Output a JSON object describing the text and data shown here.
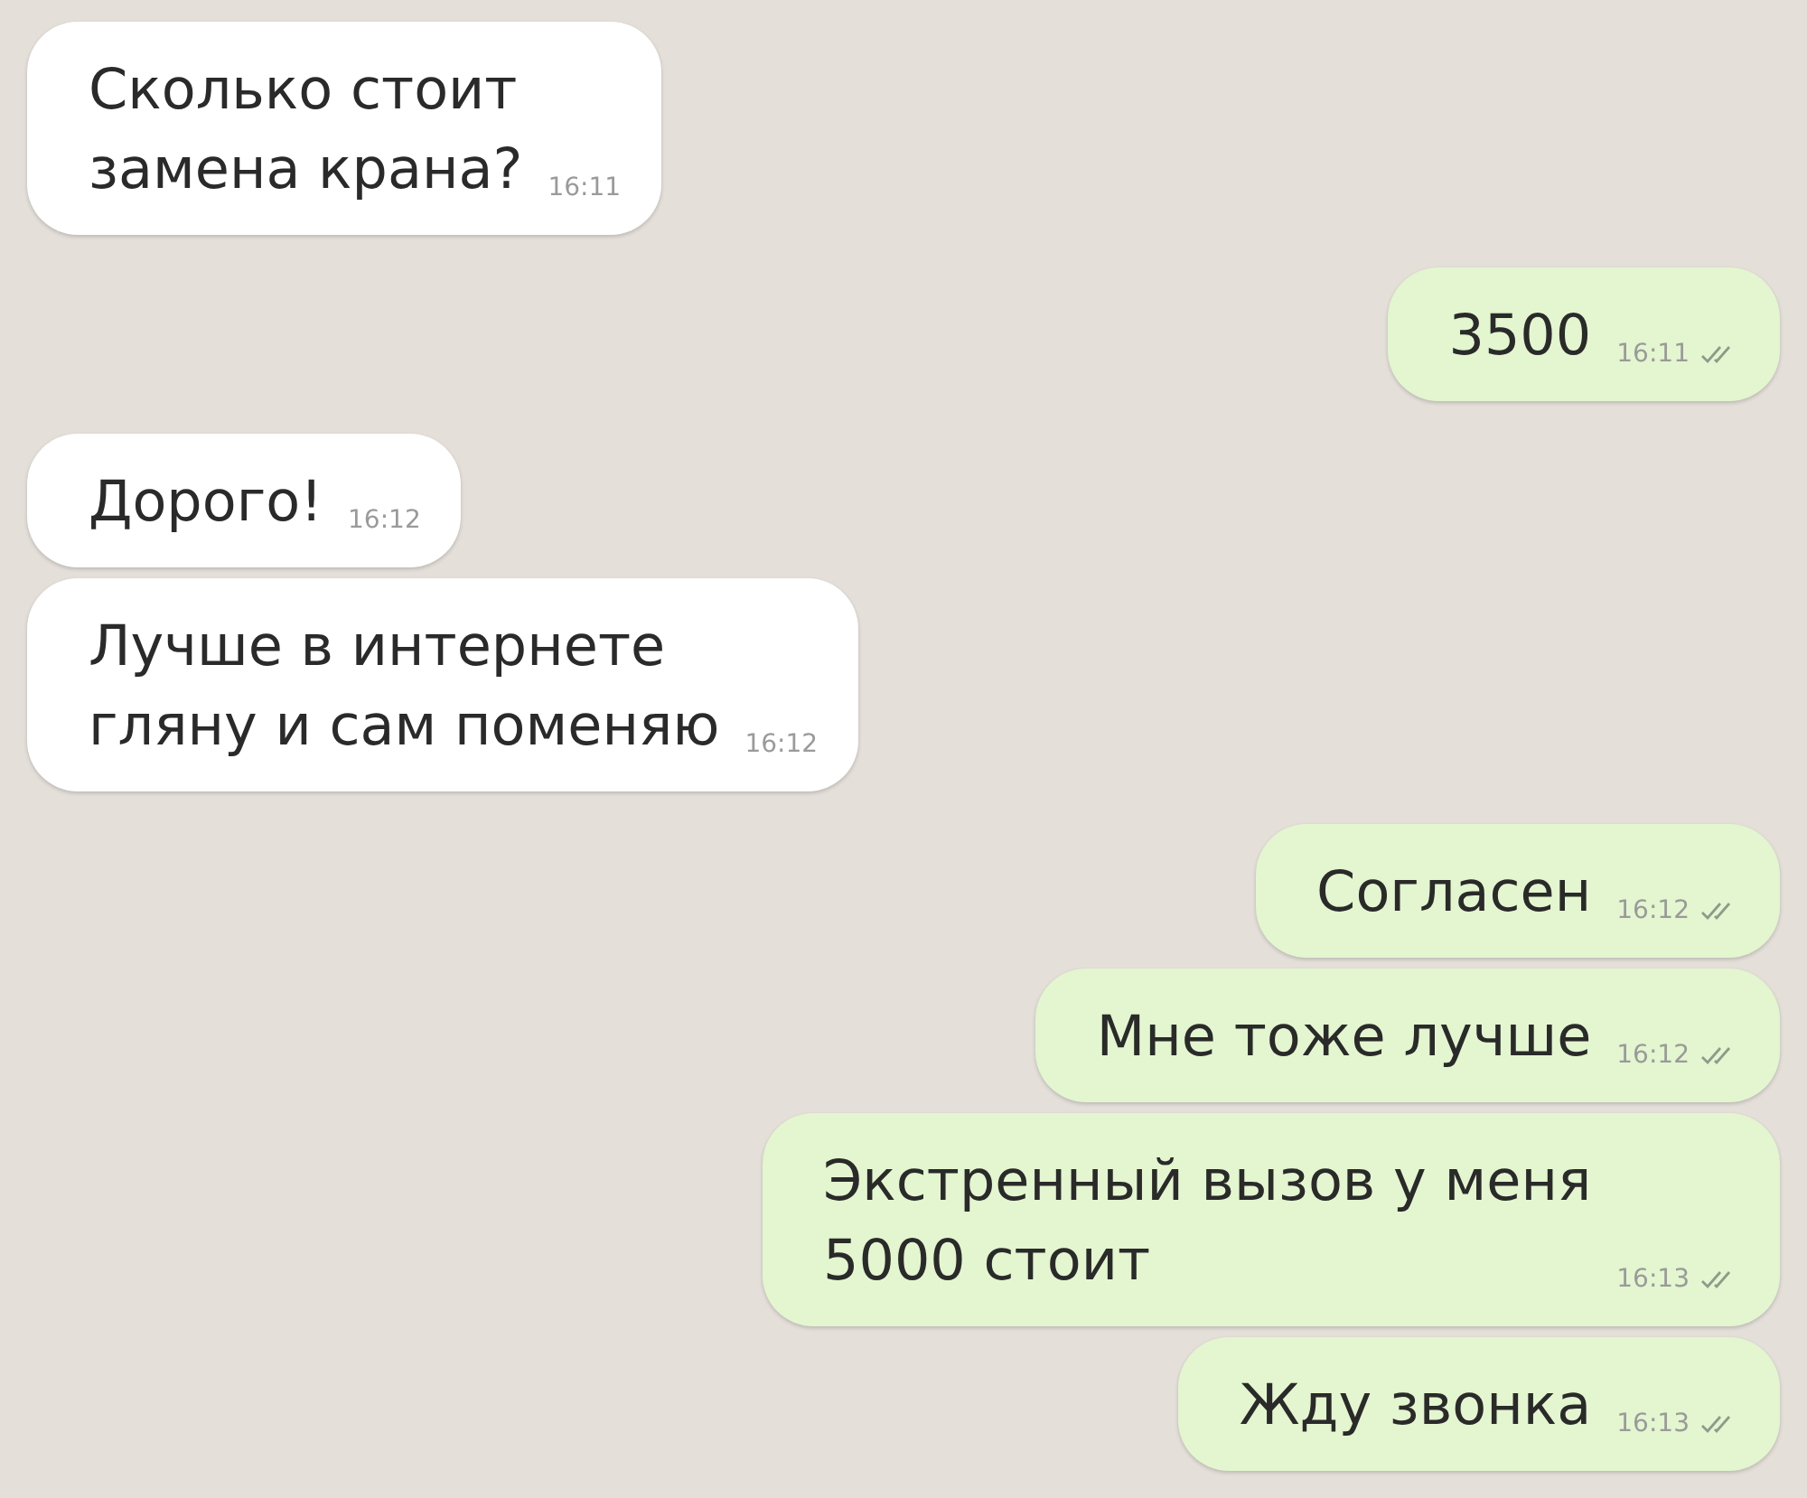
{
  "messages": [
    {
      "kind": "incoming",
      "text": "Сколько стоит\nзамена крана?",
      "time": "16:11"
    },
    {
      "kind": "outgoing",
      "text": "3500",
      "time": "16:11"
    },
    {
      "kind": "incoming",
      "text": "Дорого!",
      "time": "16:12"
    },
    {
      "kind": "incoming",
      "text": "Лучше в интернете\nгляну и сам поменяю",
      "time": "16:12"
    },
    {
      "kind": "outgoing",
      "text": "Согласен",
      "time": "16:12"
    },
    {
      "kind": "outgoing",
      "text": "Мне тоже лучше",
      "time": "16:12"
    },
    {
      "kind": "outgoing",
      "text": "Экстренный вызов у меня\n5000 стоит",
      "time": "16:13"
    },
    {
      "kind": "outgoing",
      "text": "Жду звонка",
      "time": "16:13"
    }
  ]
}
